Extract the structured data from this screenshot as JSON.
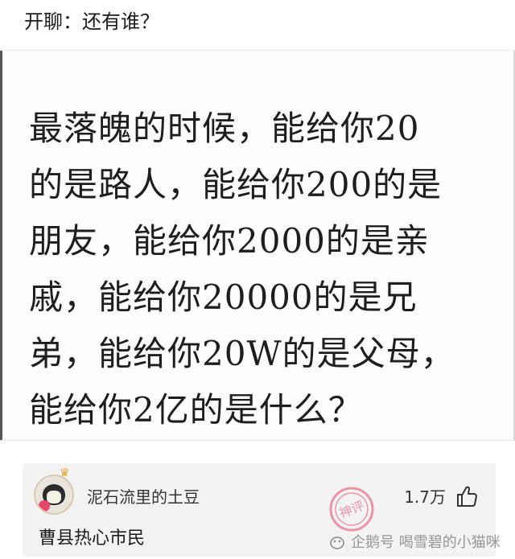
{
  "header": {
    "title": "开聊：还有谁？"
  },
  "image_text": {
    "lines": [
      "最落魄的时候，能给你20",
      "的是路人，能给你200的是",
      "朋友，能给你2000的是亲",
      "戚，能给你20000的是兄",
      "弟，能给你20W的是父母，",
      "能给你2亿的是什么？"
    ]
  },
  "comment": {
    "username": "泥石流里的土豆",
    "likes": "1.7万",
    "text": "曹县热心市民",
    "avatar_icon": "potato-avatar-icon",
    "like_icon": "thumbs-up-icon"
  },
  "watermark": {
    "stamp_text": "神评",
    "text": "企鹅号 喝雪碧的小猫咪",
    "icon": "penguin-icon"
  },
  "colors": {
    "accent_pink": "#e8456b",
    "card_bg": "#f3f3f3",
    "text": "#1a1a1a"
  }
}
